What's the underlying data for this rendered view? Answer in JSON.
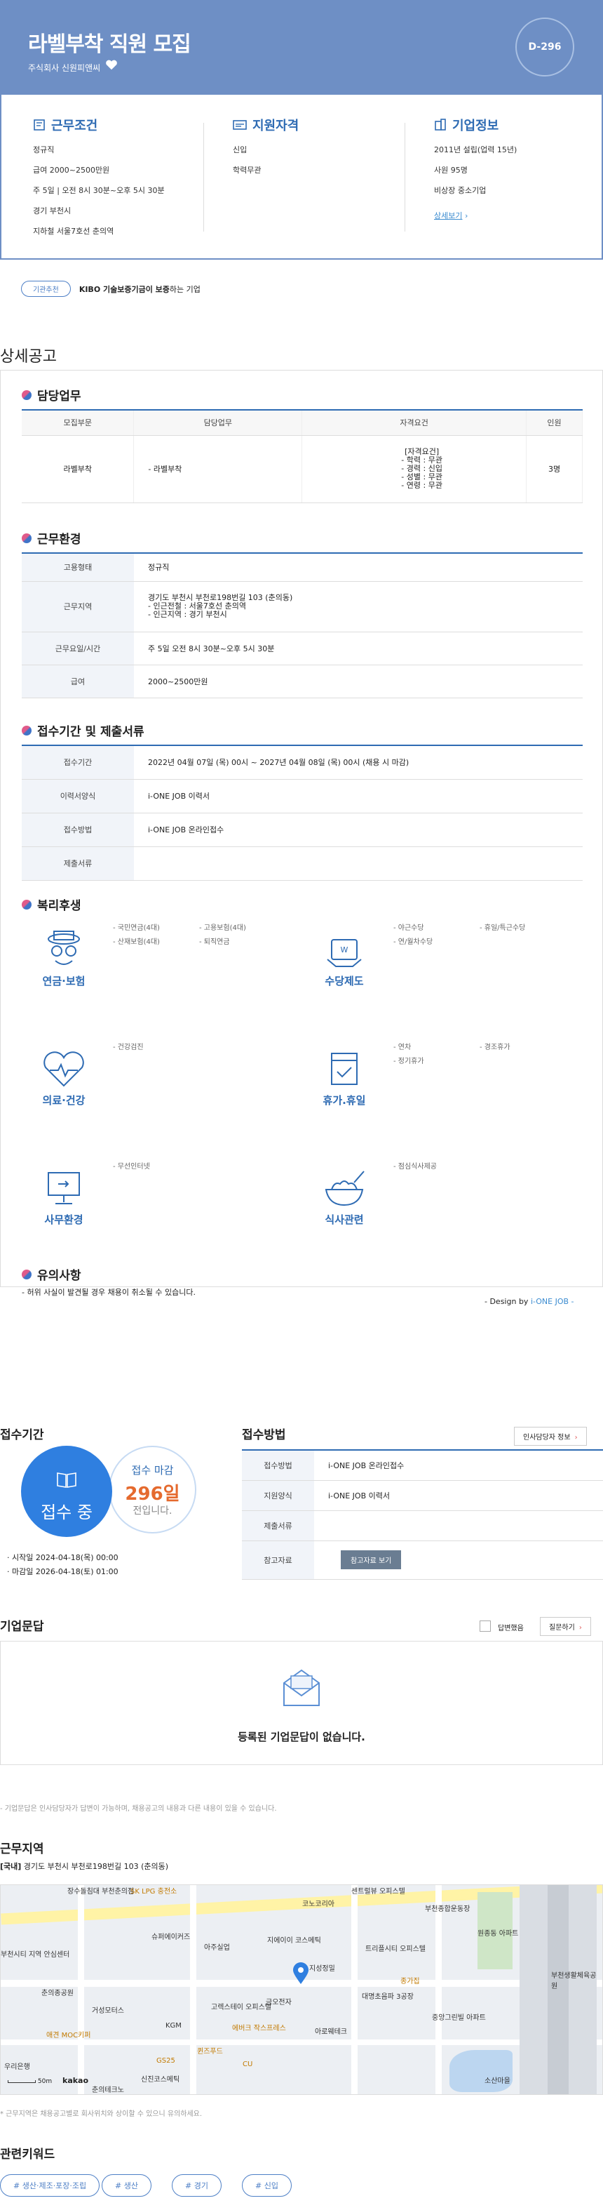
{
  "header": {
    "title": "라벨부착 직원 모집",
    "company": "주식회사 신원피앤씨",
    "dday": "D-296"
  },
  "summary": {
    "conditions": {
      "title": "근무조건",
      "items": [
        "정규직",
        "급여 2000~2500만원",
        "주 5일 | 오전 8시 30분~오후 5시 30분",
        "경기 부천시",
        "지하철 서울7호선 춘의역"
      ]
    },
    "qualification": {
      "title": "지원자격",
      "items": [
        "신입",
        "학력무관"
      ]
    },
    "company": {
      "title": "기업정보",
      "items": [
        "2011년 설립(업력 15년)",
        "사원 95명",
        "비상장 중소기업"
      ],
      "more": "상세보기"
    }
  },
  "kibo": {
    "pill": "기관추천",
    "bold": "KIBO 기술보증기금이 보증",
    "rest": "하는 기업"
  },
  "detail": {
    "title": "상세공고",
    "duty": {
      "title": "담당업무",
      "headers": [
        "모집부문",
        "담당업무",
        "자격요건",
        "인원"
      ],
      "row": [
        "라벨부착",
        "- 라벨부착",
        "[자격요건]\n- 학력 : 무관\n- 경력 : 신입\n- 성별 : 무관\n- 연령 : 무관",
        "3명"
      ]
    },
    "env": {
      "title": "근무환경",
      "rows": [
        {
          "k": "고용형태",
          "v": "정규직"
        },
        {
          "k": "근무지역",
          "v": "경기도 부천시 부천로198번길 103 (춘의동)\n- 인근전철 : 서울7호선 춘의역\n- 인근지역 : 경기 부천시"
        },
        {
          "k": "근무요일/시간",
          "v": "주 5일 오전 8시 30분~오후 5시 30분"
        },
        {
          "k": "급여",
          "v": "2000~2500만원"
        }
      ]
    },
    "receipt": {
      "title": "접수기간 및 제출서류",
      "rows": [
        {
          "k": "접수기간",
          "v": "2022년 04월 07일 (목) 00시 ~ 2027년 04월 08일 (목) 00시 (채용 시 마감)"
        },
        {
          "k": "이력서양식",
          "v": "i-ONE JOB 이력서"
        },
        {
          "k": "접수방법",
          "v": "i-ONE JOB 온라인접수"
        },
        {
          "k": "제출서류",
          "v": ""
        }
      ]
    },
    "welfare": {
      "title": "복리후생",
      "groups": [
        {
          "name": "연금·보험",
          "icon": "pension-icon",
          "items": [
            "- 국민연금(4대)",
            "- 고용보험(4대)",
            "- 산재보험(4대)",
            "- 퇴직연금"
          ]
        },
        {
          "name": "수당제도",
          "icon": "allowance-icon",
          "items": [
            "- 야근수당",
            "- 휴일/특근수당",
            "- 연/월차수당"
          ]
        },
        {
          "name": "의료·건강",
          "icon": "health-icon",
          "items": [
            "- 건강검진"
          ]
        },
        {
          "name": "휴가.휴일",
          "icon": "calendar-icon",
          "items": [
            "- 연차",
            "- 경조휴가",
            "- 정기휴가"
          ]
        },
        {
          "name": "사무환경",
          "icon": "monitor-icon",
          "items": [
            "- 무선인터넷"
          ]
        },
        {
          "name": "식사관련",
          "icon": "meal-icon",
          "items": [
            "- 점심식사제공"
          ]
        }
      ]
    },
    "notice": {
      "title": "유의사항",
      "text": "- 허위 사실이 발견될 경우 채용이 취소될 수 있습니다.",
      "design_prefix": "- Design by ",
      "design_brand": "i-ONE JOB",
      "design_suffix": " -"
    }
  },
  "apply": {
    "period_title": "접수기간",
    "status": "접수 중",
    "deadline_label": "접수 마감",
    "deadline_days": "296일",
    "deadline_suffix": "전입니다.",
    "start": "시작일 2024-04-18(목) 00:00",
    "end": "마감일 2026-04-18(토) 01:00",
    "method_title": "접수방법",
    "hr_button": "인사담당자 정보",
    "rows": [
      {
        "k": "접수방법",
        "v": "i-ONE JOB 온라인접수"
      },
      {
        "k": "지원양식",
        "v": "i-ONE JOB 이력서"
      },
      {
        "k": "제출서류",
        "v": ""
      },
      {
        "k": "참고자료",
        "v": ""
      }
    ],
    "ref_button": "참고자료 보기"
  },
  "qa": {
    "title": "기업문답",
    "reply_label": "답변했음",
    "ask_button": "질문하기",
    "empty": "등록된 기업문답이 없습니다.",
    "note": "- 기업문답은 인사담당자가 답변이 가능하며, 채용공고의 내용과 다른 내용이 있을 수 있습니다."
  },
  "location": {
    "title": "근무지역",
    "tag": "[국내]",
    "address": "경기도 부천시 부천로198번길 103 (춘의동)",
    "map_labels": [
      "장수돌침대 부천춘의점",
      "SK LPG 충전소",
      "센트럴뷰 오피스텔",
      "부천종합운동장",
      "코노코리아",
      "슈퍼에이커즈",
      "아주실업",
      "지에이이 코스메틱",
      "트리플시티 오피스텔",
      "원종동 아파트",
      "부천시티 지역 안심센터",
      "춘의종공원",
      "지성정밀",
      "거성모터스",
      "고렉스테이 오피스텔",
      "금오전자",
      "대명초음파 3공장",
      "종가집",
      "중앙그린빌 아파트",
      "KGM",
      "애견 MOC키퍼",
      "에버크 작스프레스",
      "아로웨테크",
      "퀸즈푸드",
      "GS25",
      "CU",
      "우리은행",
      "신진코스메틱",
      "춘의테크노",
      "소산마을",
      "부천생활체육공원"
    ],
    "scale": "50m",
    "map_brand": "kakao",
    "note": "* 근무지역은 채용공고별로 회사위치와 상이할 수 있으니 유의하세요."
  },
  "keywords": {
    "title": "관련키워드",
    "items": [
      "# 생산·제조·포장·조립",
      "# 생산",
      "# 경기",
      "# 신입"
    ]
  }
}
